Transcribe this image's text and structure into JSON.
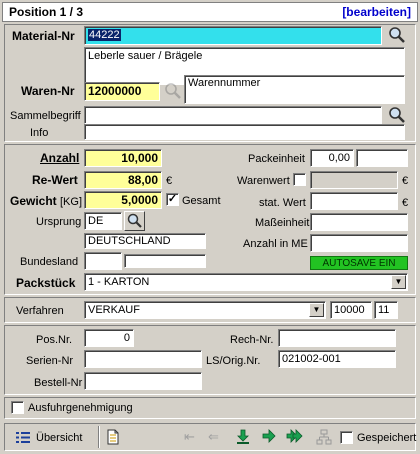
{
  "header": {
    "title": "Position 1 / 3",
    "edit_link": "[bearbeiten]"
  },
  "material": {
    "label": "Material-Nr",
    "value": "44222",
    "description": "Leberle sauer / Brägele"
  },
  "waren": {
    "label": "Waren-Nr",
    "value": "12000000",
    "description": "Warennummer"
  },
  "sammelbegriff": {
    "label": "Sammelbegriff",
    "value": ""
  },
  "info": {
    "label": "Info",
    "value": ""
  },
  "anzahl": {
    "label": "Anzahl",
    "value": "10,000"
  },
  "rewert": {
    "label": "Re-Wert",
    "value": "88,00",
    "currency": "€"
  },
  "gewicht": {
    "label": "Gewicht",
    "unit": "[KG]",
    "value": "5,0000",
    "gesamt_label": "Gesamt",
    "gesamt_checked": "✓"
  },
  "ursprung": {
    "label": "Ursprung",
    "code": "DE",
    "country": "DEUTSCHLAND"
  },
  "bundesland": {
    "label": "Bundesland",
    "value": "",
    "value2": ""
  },
  "right_col": {
    "packeinheit_label": "Packeinheit",
    "packeinheit_value": "0,00",
    "packeinheit_unit": "",
    "warenwert_label": "Warenwert",
    "warenwert_currency": "€",
    "statwert_label": "stat. Wert",
    "statwert_currency": "€",
    "masseinheit_label": "Maßeinheit",
    "anzahl_me_label": "Anzahl in ME",
    "autosave_label": "AUTOSAVE EIN"
  },
  "packstueck": {
    "label": "Packstück",
    "value": "1 - KARTON"
  },
  "verfahren": {
    "label": "Verfahren",
    "value": "VERKAUF",
    "code1": "10000",
    "code2": "11"
  },
  "refs": {
    "posnr_label": "Pos.Nr.",
    "posnr_value": "0",
    "seriennr_label": "Serien-Nr",
    "bestellnr_label": "Bestell-Nr",
    "rechnr_label": "Rech-Nr.",
    "lsorig_label": "LS/Orig.Nr.",
    "lsorig_value": "021002-001"
  },
  "ausfuhr": {
    "label": "Ausfuhrgenehmigung"
  },
  "footer": {
    "overview_label": "Übersicht",
    "saved_label": "Gespeichert"
  }
}
